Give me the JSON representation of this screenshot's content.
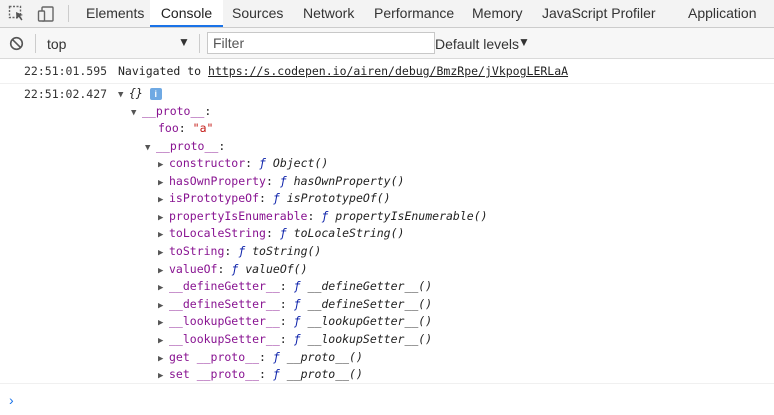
{
  "tabs": [
    {
      "label": "Elements",
      "active": false
    },
    {
      "label": "Console",
      "active": true
    },
    {
      "label": "Sources",
      "active": false
    },
    {
      "label": "Network",
      "active": false
    },
    {
      "label": "Performance",
      "active": false
    },
    {
      "label": "Memory",
      "active": false
    },
    {
      "label": "JavaScript Profiler",
      "active": false
    },
    {
      "label": "Application",
      "active": false
    }
  ],
  "toolbar": {
    "context": "top",
    "filter_placeholder": "Filter",
    "levels": "Default levels"
  },
  "messages": {
    "nav": {
      "timestamp": "22:51:01.595",
      "text": "Navigated to",
      "url": "https://s.codepen.io/airen/debug/BmzRpe/jVkpogLERLaA"
    },
    "obj": {
      "timestamp": "22:51:02.427",
      "preview": "{}",
      "info": "i",
      "proto1": "__proto__",
      "foo_key": "foo",
      "foo_val": "\"a\"",
      "proto2": "__proto__",
      "props": [
        {
          "key": "constructor",
          "fn": "Object()"
        },
        {
          "key": "hasOwnProperty",
          "fn": "hasOwnProperty()"
        },
        {
          "key": "isPrototypeOf",
          "fn": "isPrototypeOf()"
        },
        {
          "key": "propertyIsEnumerable",
          "fn": "propertyIsEnumerable()"
        },
        {
          "key": "toLocaleString",
          "fn": "toLocaleString()"
        },
        {
          "key": "toString",
          "fn": "toString()"
        },
        {
          "key": "valueOf",
          "fn": "valueOf()"
        },
        {
          "key": "__defineGetter__",
          "fn": "__defineGetter__()"
        },
        {
          "key": "__defineSetter__",
          "fn": "__defineSetter__()"
        },
        {
          "key": "__lookupGetter__",
          "fn": "__lookupGetter__()"
        },
        {
          "key": "__lookupSetter__",
          "fn": "__lookupSetter__()"
        },
        {
          "key": "get __proto__",
          "fn": "__proto__()"
        },
        {
          "key": "set __proto__",
          "fn": "__proto__()"
        }
      ]
    }
  },
  "prompt_symbol": "›",
  "fn_keyword": "ƒ",
  "colors": {
    "accent": "#1a73e8",
    "key": "#881391",
    "string": "#c41a16",
    "fn": "#0d22aa"
  }
}
